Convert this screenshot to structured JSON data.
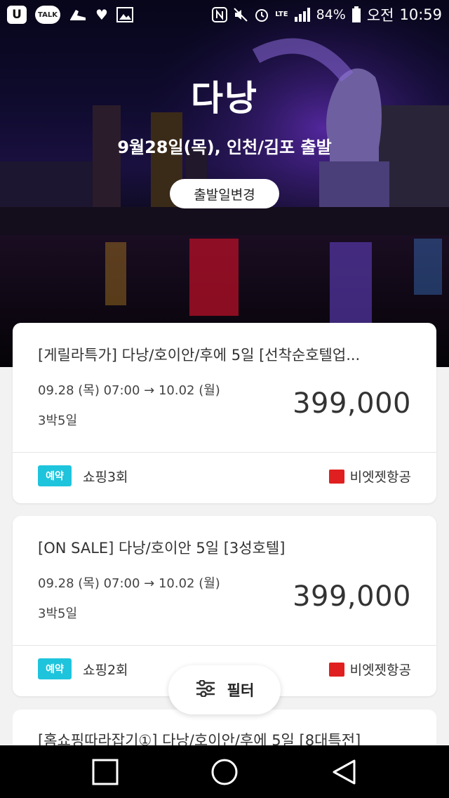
{
  "status_bar": {
    "left_icons": [
      "u-plus-icon",
      "kakaotalk-icon",
      "running-shoe-icon",
      "heart-icon",
      "image-icon"
    ],
    "u_label": "U",
    "talk_label": "TALK",
    "right_icons": [
      "nfc-icon",
      "mute-icon",
      "alarm-icon",
      "lte-icon",
      "signal-icon"
    ],
    "battery": "84%",
    "ampm": "오전",
    "time": "10:59"
  },
  "hero": {
    "title": "다낭",
    "subtitle": "9월28일(목),  인천/김포 출발",
    "change_button": "출발일변경"
  },
  "products": [
    {
      "title": "[게릴라특가] 다낭/호이안/후에 5일 [선착순호텔업...",
      "dates": "09.28 (목) 07:00  →  10.02 (월)",
      "nights": "3박5일",
      "price": "399,000",
      "badge": "예약",
      "shopping": "쇼핑3회",
      "airline": "비엣젯항공"
    },
    {
      "title": "[ON SALE] 다낭/호이안 5일 [3성호텔]",
      "dates": "09.28 (목) 07:00  →  10.02 (월)",
      "nights": "3박5일",
      "price": "399,000",
      "badge": "예약",
      "shopping": "쇼핑2회",
      "airline": "비엣젯항공"
    },
    {
      "title": "[홈쇼핑따라잡기①] 다낭/호이안/후에 5일 [8대특전]"
    }
  ],
  "filter": {
    "label": "필터"
  },
  "nav": {
    "buttons": [
      "recent-apps",
      "home",
      "back"
    ]
  },
  "colors": {
    "badge": "#1ec4dc",
    "airline_logo": "#e02020"
  }
}
